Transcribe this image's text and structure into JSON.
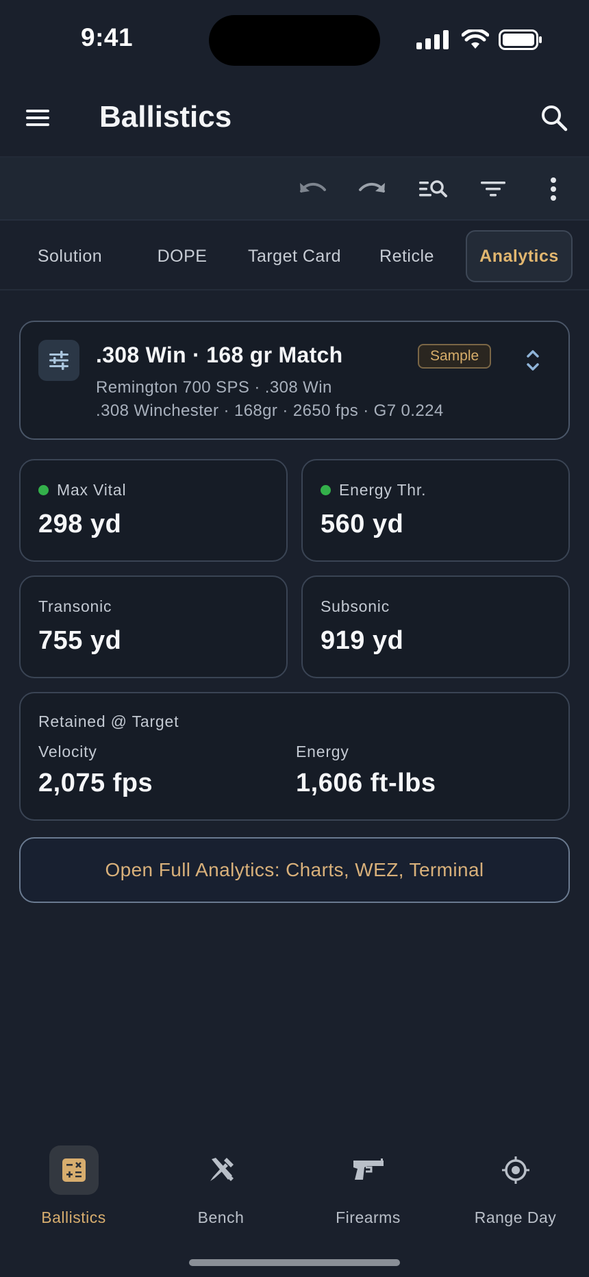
{
  "status_bar": {
    "time": "9:41"
  },
  "app_bar": {
    "title": "Ballistics"
  },
  "toolbar": {
    "items": [
      "undo-icon",
      "redo-icon",
      "search-list-icon",
      "filter-icon",
      "more-vert-icon"
    ]
  },
  "tabs": [
    {
      "label": "Solution",
      "active": false
    },
    {
      "label": "DOPE",
      "active": false
    },
    {
      "label": "Target Card",
      "active": false
    },
    {
      "label": "Reticle",
      "active": false
    },
    {
      "label": "Analytics",
      "active": true
    }
  ],
  "load": {
    "title": ".308 Win · 168 gr Match",
    "badge": "Sample",
    "rifle": "Remington 700 SPS · .308 Win",
    "details": ".308 Winchester · 168gr · 2650 fps · G7 0.224"
  },
  "stats": [
    {
      "label": "Max Vital",
      "value": "298 yd",
      "indicator": true
    },
    {
      "label": "Energy Thr.",
      "value": "560 yd",
      "indicator": true
    },
    {
      "label": "Transonic",
      "value": "755 yd",
      "indicator": false
    },
    {
      "label": "Subsonic",
      "value": "919 yd",
      "indicator": false
    }
  ],
  "retained": {
    "title": "Retained @ Target",
    "velocity_label": "Velocity",
    "velocity_value": "2,075 fps",
    "energy_label": "Energy",
    "energy_value": "1,606 ft-lbs"
  },
  "open_button": {
    "label": "Open Full Analytics: Charts, WEZ, Terminal"
  },
  "bottom_nav": [
    {
      "label": "Ballistics",
      "icon": "calculator-icon",
      "active": true
    },
    {
      "label": "Bench",
      "icon": "tools-icon",
      "active": false
    },
    {
      "label": "Firearms",
      "icon": "pistol-icon",
      "active": false
    },
    {
      "label": "Range Day",
      "icon": "target-icon",
      "active": false
    }
  ],
  "colors": {
    "background": "#1a202c",
    "accent": "#d7ad6e",
    "indicator_green": "#33b04a",
    "card": "#161c26"
  }
}
